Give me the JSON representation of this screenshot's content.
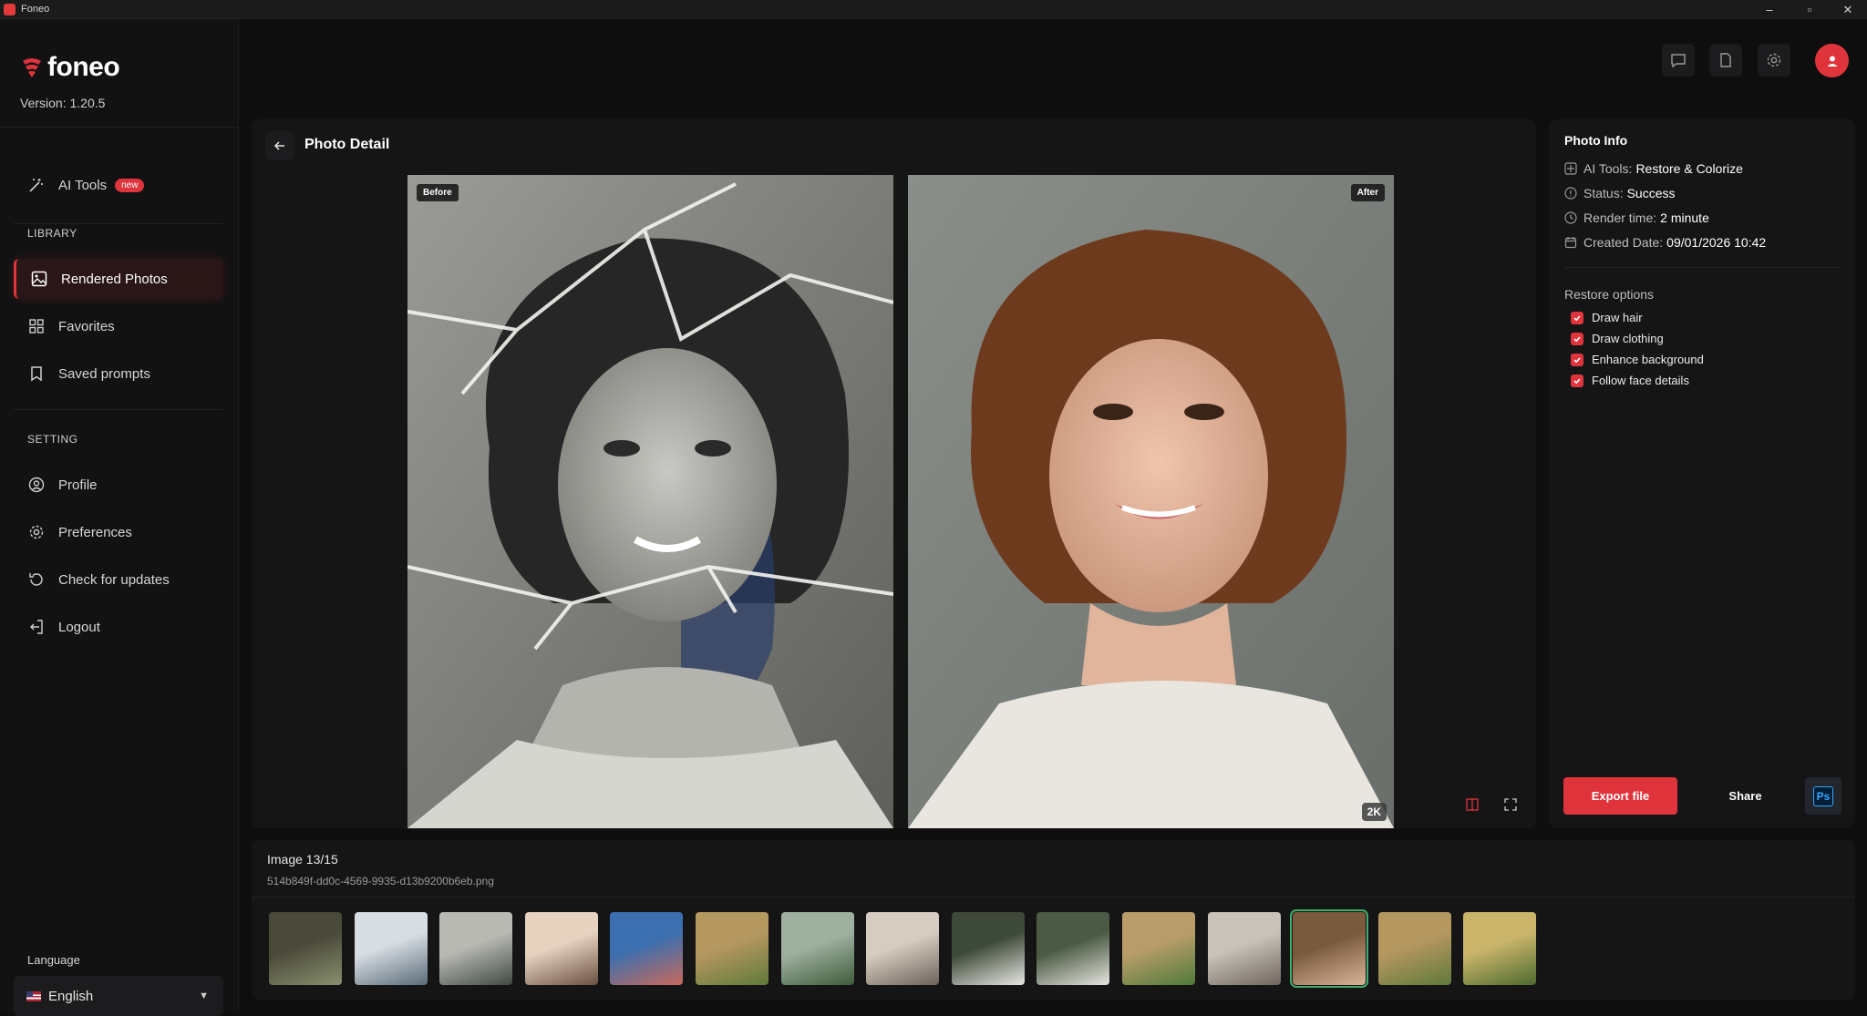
{
  "window": {
    "title": "Foneo",
    "controls": [
      "–",
      "▫",
      "✕"
    ]
  },
  "brand": {
    "name": "foneo",
    "version": "Version: 1.20.5"
  },
  "nav": {
    "ai_tools": {
      "label": "AI Tools",
      "badge": "new"
    },
    "library_label": "LIBRARY",
    "library_items": [
      {
        "label": "Rendered Photos",
        "icon": "image-icon",
        "active": true
      },
      {
        "label": "Favorites",
        "icon": "grid-icon",
        "active": false
      },
      {
        "label": "Saved prompts",
        "icon": "bookmark-icon",
        "active": false
      }
    ],
    "setting_label": "SETTING",
    "setting_items": [
      {
        "label": "Profile",
        "icon": "user-circle-icon"
      },
      {
        "label": "Preferences",
        "icon": "gear-icon"
      },
      {
        "label": "Check for updates",
        "icon": "refresh-icon"
      },
      {
        "label": "Logout",
        "icon": "logout-icon"
      }
    ]
  },
  "language": {
    "label": "Language",
    "selected": "English"
  },
  "topbar": {
    "icons": [
      "chat-icon",
      "document-icon",
      "gear-icon",
      "avatar-icon"
    ]
  },
  "detail": {
    "title": "Photo Detail",
    "before_label": "Before",
    "after_label": "After",
    "resolution": "2K"
  },
  "info": {
    "title": "Photo Info",
    "rows": [
      {
        "key": "AI Tools:",
        "value": "Restore & Colorize"
      },
      {
        "key": "Status:",
        "value": "Success"
      },
      {
        "key": "Render time:",
        "value": "2 minute"
      },
      {
        "key": "Created Date:",
        "value": "09/01/2026 10:42"
      }
    ],
    "options_label": "Restore options",
    "options": [
      "Draw hair",
      "Draw clothing",
      "Enhance background",
      "Follow face details"
    ],
    "export_label": "Export file",
    "share_label": "Share",
    "ps_label": "Ps"
  },
  "strip": {
    "title": "Image 13/15",
    "filename": "514b849f-dd0c-4569-9935-d13b9200b6eb.png",
    "selected_index": 12,
    "thumbnails": [
      {
        "colors": [
          "#4a4a3a",
          "#8a8f6e"
        ]
      },
      {
        "colors": [
          "#d7dde3",
          "#5a6b78"
        ]
      },
      {
        "colors": [
          "#b9b9b3",
          "#3f4a44"
        ]
      },
      {
        "colors": [
          "#e7d2c0",
          "#6a5040"
        ]
      },
      {
        "colors": [
          "#3b6fb0",
          "#c96a5a"
        ]
      },
      {
        "colors": [
          "#b59760",
          "#5f7a3a"
        ]
      },
      {
        "colors": [
          "#9fb0a0",
          "#3e5c3a"
        ]
      },
      {
        "colors": [
          "#d6cdc2",
          "#6e6259"
        ]
      },
      {
        "colors": [
          "#3d4a3a",
          "#e8e8e0"
        ]
      },
      {
        "colors": [
          "#4a5a44",
          "#e6e6de"
        ]
      },
      {
        "colors": [
          "#b89d6a",
          "#4f7a3a"
        ]
      },
      {
        "colors": [
          "#c9c2b8",
          "#6f665c"
        ]
      },
      {
        "colors": [
          "#7a5a3c",
          "#d9b39a"
        ]
      },
      {
        "colors": [
          "#b59760",
          "#5f7a3a"
        ]
      },
      {
        "colors": [
          "#c9b46a",
          "#4c6a2e"
        ]
      }
    ]
  },
  "colors": {
    "accent": "#e0343c",
    "panel": "#151516",
    "background": "#0e0e0f",
    "selected_outline": "#3fae6a"
  }
}
